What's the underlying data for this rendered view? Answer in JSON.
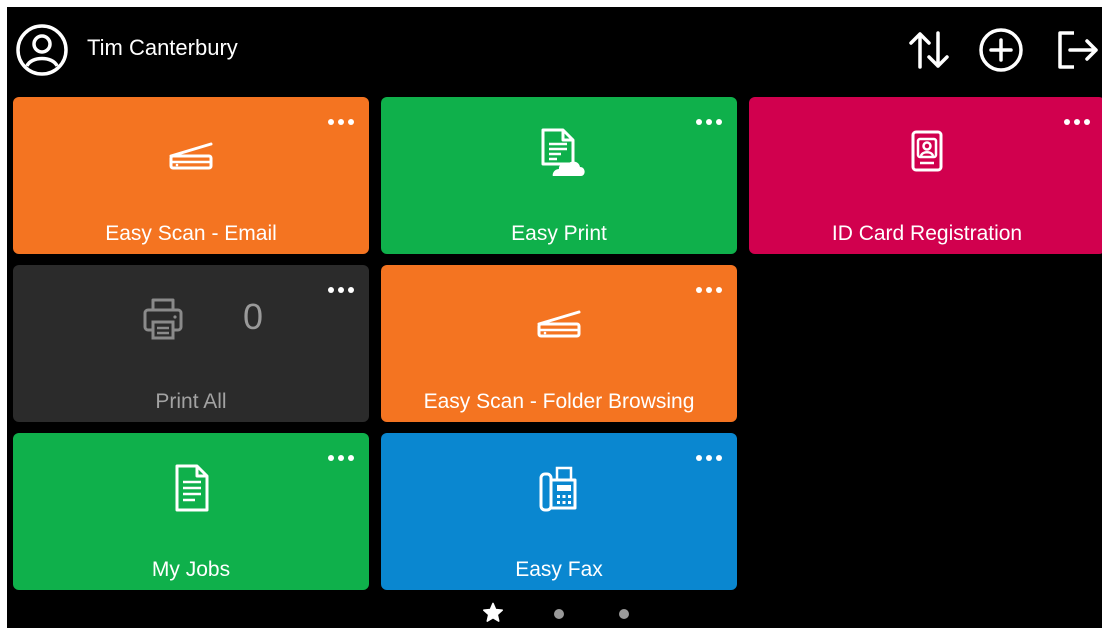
{
  "header": {
    "user_name": "Tim Canterbury",
    "icons": [
      "account-circle-icon",
      "sort-arrows-icon",
      "add-circle-icon",
      "logout-icon"
    ]
  },
  "tiles": [
    {
      "label": "Easy Scan - Email",
      "color": "#f47421",
      "icon": "scanner-icon"
    },
    {
      "label": "Easy Print",
      "color": "#0fb04b",
      "icon": "cloud-document-icon"
    },
    {
      "label": "ID Card Registration",
      "color": "#d1004e",
      "icon": "id-card-icon"
    },
    {
      "label": "Print All",
      "count": "0",
      "color": "#2b2b2b",
      "icon": "printer-icon"
    },
    {
      "label": "Easy Scan - Folder Browsing",
      "color": "#f47421",
      "icon": "scanner-icon"
    },
    {
      "label": "My Jobs",
      "color": "#0fb04b",
      "icon": "document-icon"
    },
    {
      "label": "Easy Fax",
      "color": "#0a87d0",
      "icon": "fax-icon"
    }
  ],
  "pager": {
    "pages": [
      "favorites-star-icon",
      "page-dot",
      "page-dot"
    ],
    "active_index": 0,
    "dot_color": "#9a9a9a"
  }
}
